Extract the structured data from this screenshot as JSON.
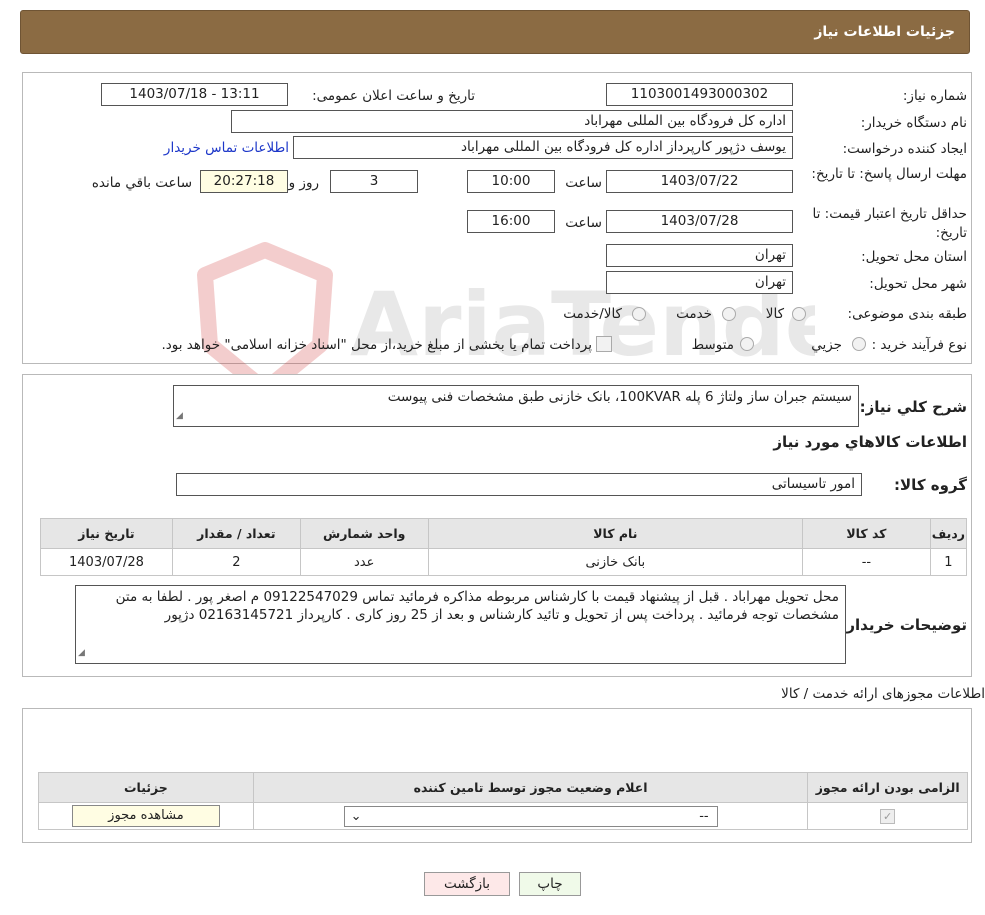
{
  "header": {
    "title": "جزئیات اطلاعات نیاز"
  },
  "need": {
    "number_label": "شماره نیاز:",
    "number_value": "1103001493000302",
    "announce_label": "تاریخ و ساعت اعلان عمومی:",
    "announce_value": "1403/07/18 - 13:11",
    "buyer_org_label": "نام دستگاه خریدار:",
    "buyer_org_value": "اداره کل فرودگاه بین المللی مهراباد",
    "creator_label": "ایجاد کننده درخواست:",
    "creator_value": "یوسف دژپور کارپرداز اداره کل فرودگاه بین المللی مهراباد",
    "contact_link": "اطلاعات تماس خریدار",
    "deadline_label": "مهلت ارسال پاسخ: تا تاریخ:",
    "deadline_date": "1403/07/22",
    "time_word": "ساعت",
    "deadline_time": "10:00",
    "days_value": "3",
    "days_word": "روز و",
    "remaining_value": "20:27:18",
    "remaining_word": "ساعت باقي مانده",
    "validity_label": "حداقل تاریخ اعتبار قیمت: تا تاریخ:",
    "validity_date": "1403/07/28",
    "validity_time": "16:00",
    "province_label": "استان محل تحویل:",
    "province_value": "تهران",
    "city_label": "شهر محل تحویل:",
    "city_value": "تهران",
    "category_label": "طبقه بندی موضوعی:",
    "category_options": [
      "کالا",
      "خدمت",
      "کالا/خدمت"
    ],
    "process_label": "نوع فرآیند خرید :",
    "process_options": [
      "جزیي",
      "متوسط"
    ],
    "process_note": "پرداخت تمام یا بخشی از مبلغ خرید،از محل \"اسناد خزانه اسلامی\" خواهد بود."
  },
  "watermark": {
    "text": "AriaTender.neT"
  },
  "summary": {
    "desc_label": "شرح کلي نياز:",
    "desc_value": "سیستم جبران ساز ولتاژ 6 پله 100KVAR، بانک خازنی طبق مشخصات فنی پیوست",
    "goods_title": "اطلاعات کالاهاي مورد نياز",
    "group_label": "گروه کالا:",
    "group_value": "امور تاسیساتی",
    "table_headers": [
      "رديف",
      "کد کالا",
      "نام کالا",
      "واحد شمارش",
      "تعداد / مقدار",
      "تاریخ نیاز"
    ],
    "rows": [
      [
        "1",
        "--",
        "بانک خازنی",
        "عدد",
        "2",
        "1403/07/28"
      ]
    ],
    "buyer_notes_label": "توضیحات خریدار:",
    "buyer_notes_value": "محل تحویل مهراباد . قبل از پیشنهاد قیمت با کارشناس مربوطه مذاکره فرمائید تماس 09122547029 م اصغر پور . لطفا به متن مشخصات توجه فرمائید . پرداخت پس از تحویل و تائید کارشناس و بعد از 25 روز کاری . کارپرداز 02163145721 دژپور"
  },
  "licenses": {
    "title": "اطلاعات مجوزهای ارائه خدمت / کالا",
    "headers": [
      "الزامی بودن ارائه مجوز",
      "اعلام وضعیت مجوز توسط تامین کننده",
      "جزئیات"
    ],
    "select_value": "--",
    "view_button": "مشاهده مجوز"
  },
  "buttons": {
    "print": "چاپ",
    "back": "بازگشت"
  }
}
